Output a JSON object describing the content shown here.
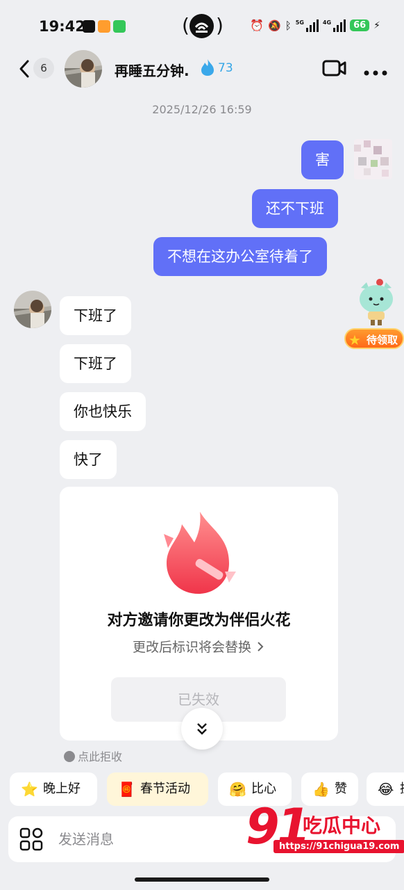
{
  "status_bar": {
    "time": "19:42",
    "battery": "66",
    "network_tags": [
      "5G",
      "4G"
    ]
  },
  "header": {
    "unread_count": "6",
    "contact_name": "再睡五分钟.",
    "spark_count": "73"
  },
  "timestamp": "2025/12/26 16:59",
  "messages": {
    "out": [
      "害",
      "还不下班",
      "不想在这办公室待着了"
    ],
    "in": [
      "下班了",
      "下班了",
      "你也快乐",
      "快了"
    ]
  },
  "claim_badge": "待领取",
  "invite_card": {
    "title": "对方邀请你更改为伴侣火花",
    "subtitle": "更改后标识将会替换",
    "button": "已失效"
  },
  "reject_link": "点此拒收",
  "quick_chips": [
    {
      "emoji": "⭐",
      "label": "晚上好"
    },
    {
      "emoji": "🧧",
      "label": "春节活动"
    },
    {
      "emoji": "🤗",
      "label": "比心"
    },
    {
      "emoji": "👍",
      "label": "赞"
    },
    {
      "emoji": "😂",
      "label": "抓"
    }
  ],
  "input": {
    "placeholder": "发送消息"
  },
  "watermark": {
    "number": "91",
    "name": "吃瓜中心",
    "url": "https://91chigua19.com"
  },
  "colors": {
    "outgoing_bubble": "#6170f7",
    "incoming_bubble": "#ffffff",
    "background": "#eeeff2",
    "spark": "#35a6e6"
  }
}
